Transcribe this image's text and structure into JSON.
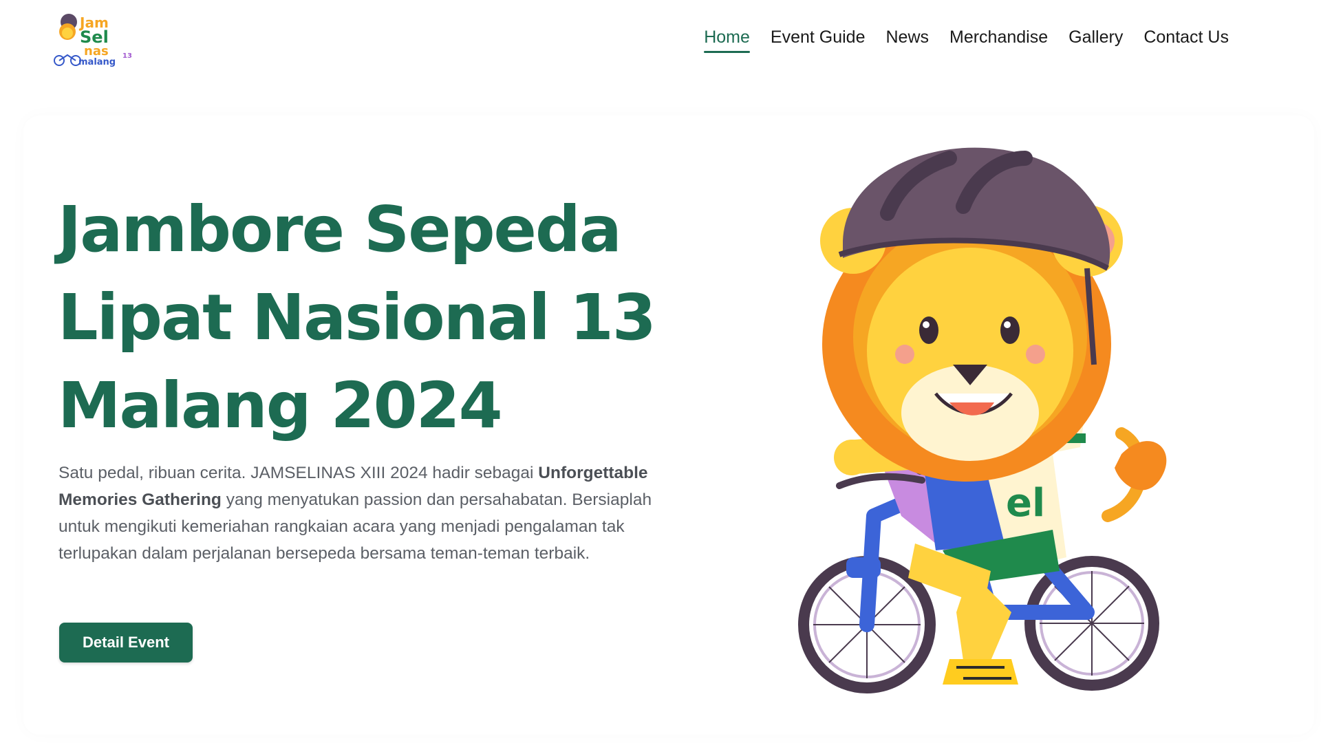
{
  "header": {
    "logo_text": "JamSelNas 13 malang",
    "nav": [
      {
        "label": "Home",
        "active": true
      },
      {
        "label": "Event Guide",
        "active": false
      },
      {
        "label": "News",
        "active": false
      },
      {
        "label": "Merchandise",
        "active": false
      },
      {
        "label": "Gallery",
        "active": false
      },
      {
        "label": "Contact Us",
        "active": false
      }
    ]
  },
  "hero": {
    "title_lines": [
      "Jambore Sepeda",
      "Lipat Nasional 13",
      "Malang 2024"
    ],
    "desc_part1": "Satu pedal, ribuan cerita. JAMSELINAS XIII 2024 hadir sebagai ",
    "desc_bold": "Unforgettable Memories Gathering",
    "desc_part2": " yang menyatukan passion dan persahabatan. Bersiaplah untuk mengikuti kemeriahan rangkaian acara yang menjadi pengalaman tak terlupakan dalam perjalanan bersepeda bersama teman-teman terbaik.",
    "cta_label": "Detail Event"
  },
  "colors": {
    "brand_green": "#1d6b52",
    "text_gray": "#5b5f66"
  }
}
